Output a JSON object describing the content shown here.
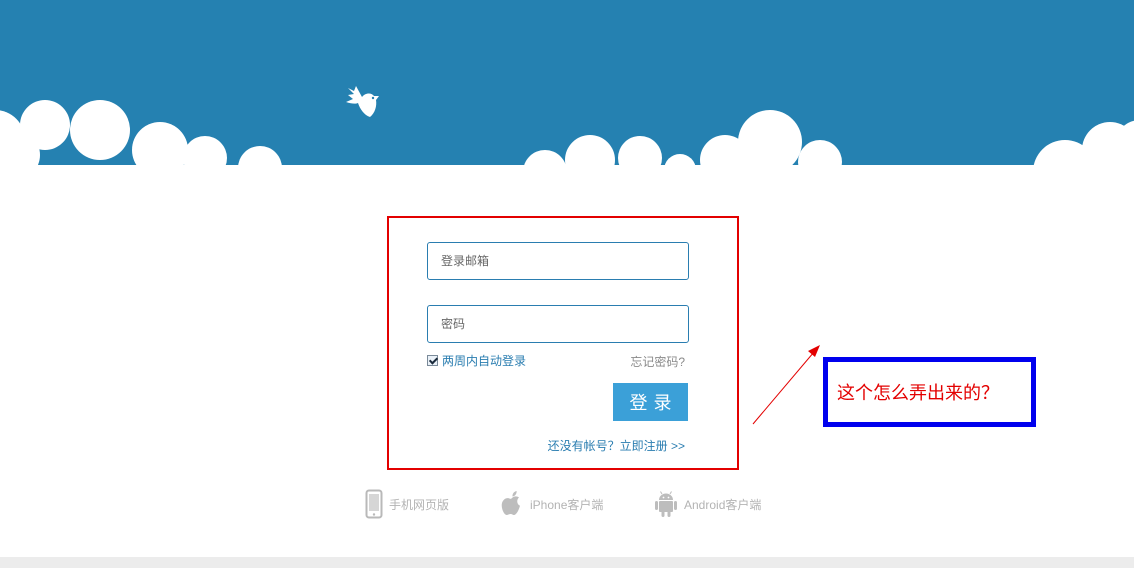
{
  "colors": {
    "sky": "#2581b1",
    "cloud": "#ffffff",
    "accent": "#3ba0d8",
    "link": "#2a7db0",
    "muted": "#b3b3b3",
    "annotation_frame": "#0000ee",
    "annotation_text": "#e30000",
    "highlight_frame": "#e30000"
  },
  "header": {
    "logo_icon": "dove-icon"
  },
  "login": {
    "email_placeholder": "登录邮箱",
    "password_placeholder": "密码",
    "remember_checked": true,
    "remember_label": "两周内自动登录",
    "forgot_label": "忘记密码?",
    "submit_label": "登录",
    "register_label": "还没有帐号？立即注册 >>"
  },
  "clients": [
    {
      "icon": "mobile-phone-icon",
      "label": "手机网页版"
    },
    {
      "icon": "apple-icon",
      "label": "iPhone客户端"
    },
    {
      "icon": "android-icon",
      "label": "Android客户端"
    }
  ],
  "annotation": {
    "text": "这个怎么弄出来的？"
  }
}
